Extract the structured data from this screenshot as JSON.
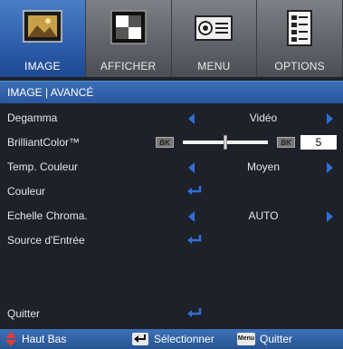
{
  "tabs": [
    {
      "label": "IMAGE",
      "icon": "picture-icon",
      "active": true
    },
    {
      "label": "AFFICHER",
      "icon": "display-icon",
      "active": false
    },
    {
      "label": "MENU",
      "icon": "projector-icon",
      "active": false
    },
    {
      "label": "OPTIONS",
      "icon": "document-icon",
      "active": false
    }
  ],
  "header": {
    "title": "IMAGE | AVANCÉ"
  },
  "rows": {
    "degamma": {
      "label": "Degamma",
      "value": "Vidéo"
    },
    "brilliant": {
      "label": "BrilliantColor™",
      "value": "5",
      "bk_left": "BK",
      "bk_right": "BK",
      "level": 0.5
    },
    "temp": {
      "label": "Temp. Couleur",
      "value": "Moyen"
    },
    "couleur": {
      "label": "Couleur"
    },
    "echelle": {
      "label": "Echelle Chroma.",
      "value": "AUTO"
    },
    "source": {
      "label": "Source d'Entrée"
    },
    "quitter": {
      "label": "Quitter"
    }
  },
  "footer": {
    "updown": "Haut Bas",
    "select": "Sélectionner",
    "menu_key": "Menu",
    "quit": "Quitter"
  },
  "colors": {
    "accent": "#2e6fd6",
    "header": "#2f61a8",
    "background": "#1e2129"
  }
}
